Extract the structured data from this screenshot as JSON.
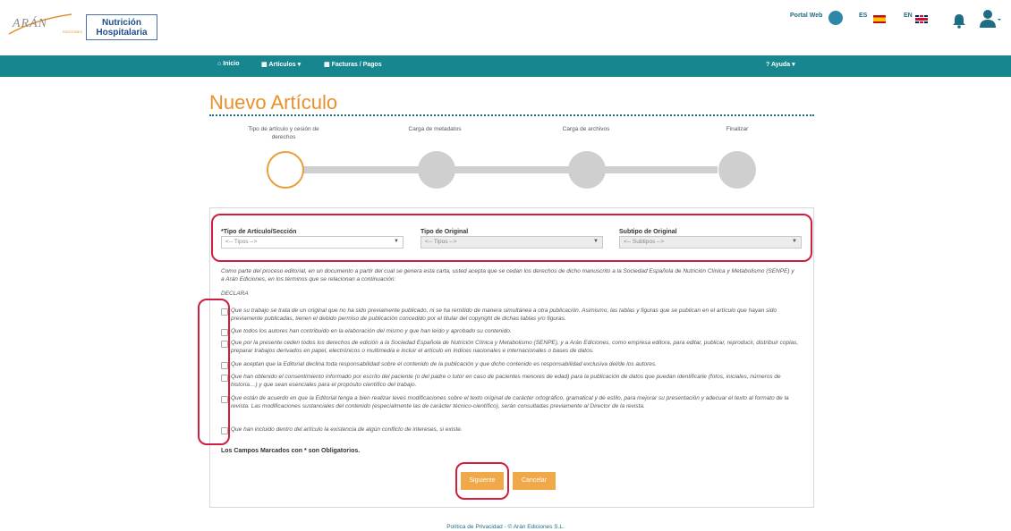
{
  "header": {
    "logo_aran": "ARÁN",
    "logo_aran_sub": "EDICIONES",
    "logo_journal": "Nutrición Hospitalaria",
    "portal_web": "Portal Web",
    "lang_es": "ES",
    "lang_en": "EN"
  },
  "nav": {
    "inicio": "Inicio",
    "articulos": "Artículos",
    "facturas": "Facturas / Pagos",
    "ayuda": "? Ayuda"
  },
  "page": {
    "title": "Nuevo Artículo"
  },
  "steps": [
    {
      "label": "Tipo de artículo y cesión de derechos",
      "active": true
    },
    {
      "label": "Carga de metadatos",
      "active": false
    },
    {
      "label": "Carga de archivos",
      "active": false
    },
    {
      "label": "Finalizar",
      "active": false
    }
  ],
  "selects": {
    "tipo_articulo": {
      "label": "*Tipo de Artículo/Sección",
      "value": "<-- Tipos -->"
    },
    "tipo_original": {
      "label": "Tipo de Original",
      "value": "<-- Tipos -->"
    },
    "subtipo_original": {
      "label": "Subtipo de Original",
      "value": "<-- Subtipos -->"
    }
  },
  "intro": "Como parte del proceso editorial, en un documento a partir del cual se genera esta carta, usted acepta que se cedan los derechos de dicho manuscrito a la Sociedad Española de Nutrición Clínica y Metabolismo (SENPE) y a Arán Ediciones, en los términos que se relacionan a continuación:",
  "declara": "DECLARA",
  "declarations": [
    "Que su trabajo se trata de un original que no ha sido previamente publicado, ni se ha remitido de manera simultánea a otra publicación. Asimismo, las tablas y figuras que se publican en el artículo que hayan sido previamente publicadas, tienen el debido permiso de publicación concedido por el titular del copyright de dichas tablas y/o figuras.",
    "Que todos los autores han contribuido en la elaboración del mismo y que han leído y aprobado su contenido.",
    "Que por la presente ceden todos los derechos de edición a la Sociedad Española de Nutrición Clínica y Metabolismo (SENPE), y a Arán Ediciones, como empresa editora, para editar, publicar, reproducir, distribuir copias, preparar trabajos derivados en papel, electrónicos o multimedia e incluir el artículo en índices nacionales e internacionales o bases de datos.",
    "Que aceptan que la Editorial declina toda responsabilidad sobre el contenido de la publicación y que dicho contenido es responsabilidad exclusiva del/de los autores.",
    "Que han obtenido el consentimiento informado por escrito del paciente (o del padre o tutor en caso de pacientes menores de edad) para la publicación de datos que puedan identificarle (fotos, iniciales, números de historia…) y que sean esenciales para el propósito científico del trabajo.",
    "Que están de acuerdo en que la Editorial tenga a bien realizar leves modificaciones sobre el texto original de carácter ortográfico, gramatical y de estilo, para mejorar su presentación y adecuar el texto al formato de la revista. Las modificaciones sustanciales del contenido (especialmente las de carácter técnico-científico), serán consultadas previamente al Director de la revista.",
    "Que han incluido dentro del artículo la existencia de algún conflicto de intereses, si existe."
  ],
  "mandatory_note": "Los Campos Marcados con * son Obligatorios.",
  "buttons": {
    "next": "Siguiente",
    "cancel": "Cancelar"
  },
  "footer": "Política de Privacidad - © Arán Ediciones S.L.",
  "colors": {
    "nav_bg": "#17868f",
    "accent_orange": "#e8902b",
    "highlight_red": "#d01e3c"
  }
}
